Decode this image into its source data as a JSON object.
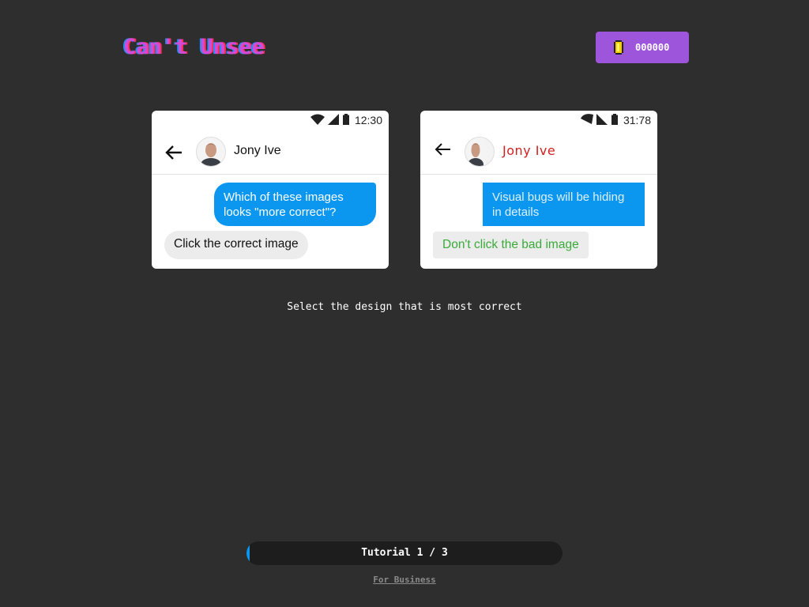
{
  "header": {
    "logo_text": "Can't Unsee",
    "coins": "000000"
  },
  "colors": {
    "background": "#2e2e2e",
    "accent_blue": "#0b97f0",
    "coin_button": "#9d55db"
  },
  "cards": {
    "left": {
      "status_time": "12:30",
      "contact_name": "Jony Ive",
      "outgoing_message": "Which of these images looks \"more correct\"?",
      "incoming_message": "Click the correct image"
    },
    "right": {
      "status_time": "31:78",
      "contact_name": "Jony Ive",
      "outgoing_message": "Visual bugs will be hiding in details",
      "incoming_message": "Don't click the bad image"
    }
  },
  "instruction": "Select the design that is most correct",
  "progress": {
    "label": "Tutorial 1 / 3",
    "fraction": 0.01
  },
  "footer": {
    "business_link": "For Business"
  },
  "icons": [
    "coin-icon",
    "wifi-icon",
    "signal-icon",
    "battery-icon",
    "back-arrow-icon",
    "avatar"
  ]
}
